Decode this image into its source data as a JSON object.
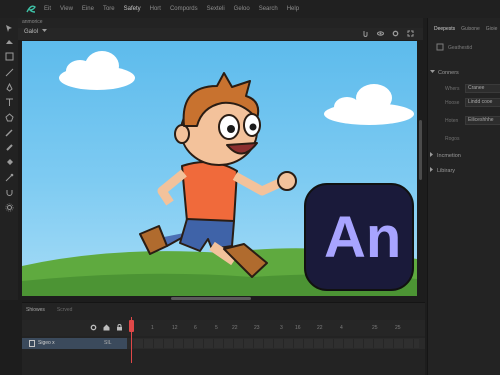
{
  "menu": {
    "items": [
      "Eit",
      "View",
      "Eine",
      "Tore",
      "Safety",
      "Hort",
      "Compords",
      "Sexteli",
      "Geloo",
      "Search",
      "Help"
    ]
  },
  "document_tab": "anmorice",
  "scene": {
    "selected": "Galol",
    "tools": [
      "clip-icon",
      "eye-icon",
      "gear-icon",
      "expand-icon"
    ]
  },
  "stage": {
    "badge_text": "An",
    "badge_color": "#1a1a3a",
    "badge_text_color": "#a8a4ff"
  },
  "right_panel": {
    "tabs": [
      "Deepests",
      "Guisone",
      "Gioie"
    ],
    "header_label": "Geathestid",
    "sections": [
      {
        "label": "Conners",
        "rows": [
          {
            "label": "Whers",
            "value": "Cranee"
          },
          {
            "label": "Hoose",
            "value": "Lindd cooe"
          },
          {
            "label": "Hoten",
            "value": "Eiliceshhhe"
          },
          {
            "label": "Rogos",
            "value": ""
          }
        ]
      },
      {
        "label": "Incmetion",
        "rows": []
      },
      {
        "label": "Libirary",
        "rows": []
      }
    ]
  },
  "timeline": {
    "tabs": [
      "Shiowes",
      "Scrved"
    ],
    "frame_numbers": [
      "1",
      "12",
      "6",
      "5",
      "22",
      "23",
      "3",
      "16",
      "22",
      "4",
      "25",
      "25"
    ],
    "layer": {
      "name": "Sigeo x",
      "value": "SIL"
    }
  }
}
